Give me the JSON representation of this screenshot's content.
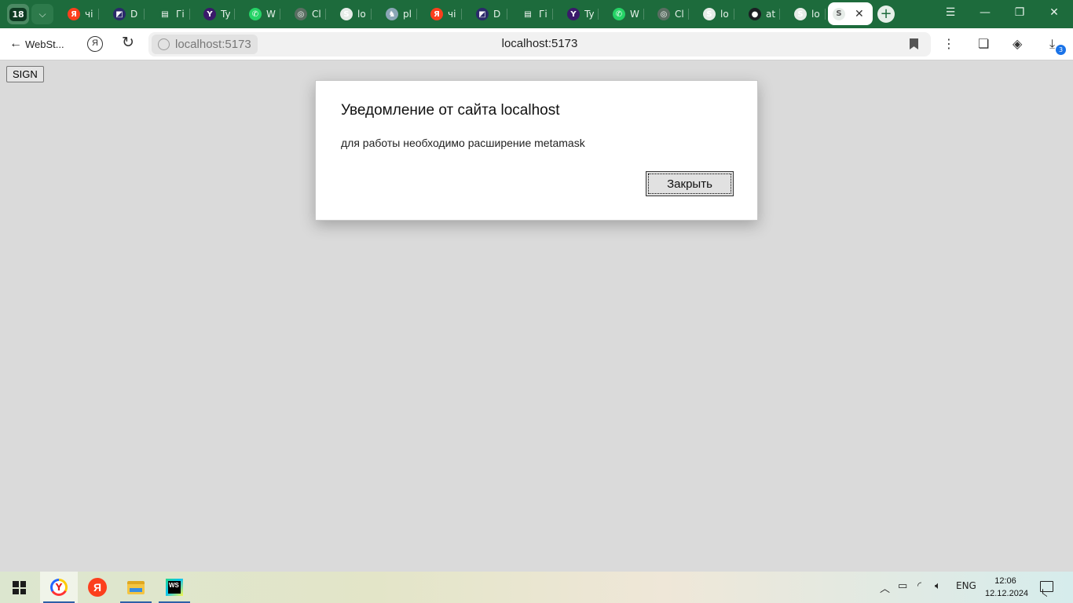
{
  "browser": {
    "tab_count": "18",
    "tabs": [
      {
        "icon": "yandex-icon",
        "color": "#fc3f1d",
        "glyph": "Я",
        "title": "чі"
      },
      {
        "icon": "figma-like-icon",
        "color": "#2a2a6a",
        "glyph": "◩",
        "title": "D"
      },
      {
        "icon": "document-icon",
        "color": "#1d6b3c",
        "glyph": "▤",
        "title": "Гі"
      },
      {
        "icon": "purple-y-icon",
        "color": "#3a1a6a",
        "glyph": "Y",
        "title": "Ty"
      },
      {
        "icon": "whatsapp-icon",
        "color": "#25d366",
        "glyph": "✆",
        "title": "W"
      },
      {
        "icon": "chatgpt-icon",
        "color": "#5a6e62",
        "glyph": "◎",
        "title": "Cl"
      },
      {
        "icon": "svelte-like-icon",
        "color": "#e6ece8",
        "glyph": "S",
        "title": "lo"
      },
      {
        "icon": "postgres-icon",
        "color": "#8aa6b6",
        "glyph": "♞",
        "title": "pl"
      },
      {
        "icon": "yandex-icon",
        "color": "#fc3f1d",
        "glyph": "Я",
        "title": "чі"
      },
      {
        "icon": "figma-like-icon",
        "color": "#2a2a6a",
        "glyph": "◩",
        "title": "D"
      },
      {
        "icon": "document-icon",
        "color": "#1d6b3c",
        "glyph": "▤",
        "title": "Гі"
      },
      {
        "icon": "purple-y-icon",
        "color": "#3a1a6a",
        "glyph": "Y",
        "title": "Ty"
      },
      {
        "icon": "whatsapp-icon",
        "color": "#25d366",
        "glyph": "✆",
        "title": "W"
      },
      {
        "icon": "chatgpt-icon",
        "color": "#5a6e62",
        "glyph": "◎",
        "title": "Cl"
      },
      {
        "icon": "svelte-like-icon",
        "color": "#e6ece8",
        "glyph": "S",
        "title": "lo"
      },
      {
        "icon": "github-icon",
        "color": "#1b1f23",
        "glyph": "●",
        "title": "at"
      },
      {
        "icon": "svelte-like-icon",
        "color": "#e6ece8",
        "glyph": "S",
        "title": "lo"
      }
    ],
    "active_tab": {
      "icon": "svelte-like-icon"
    },
    "back_label": "WebSt...",
    "url_chip": "localhost:5173",
    "url_title": "localhost:5173",
    "download_count": "3"
  },
  "page": {
    "sign_button": "SIGN"
  },
  "dialog": {
    "title": "Уведомление от сайта localhost",
    "message": "для работы необходимо расширение metamask",
    "close_button": "Закрыть"
  },
  "taskbar": {
    "language": "ENG",
    "time": "12:06",
    "date": "12.12.2024"
  },
  "colors": {
    "tabstrip": "#1d6b3c",
    "page_background": "#dadada",
    "dialog_background": "#ffffff"
  }
}
